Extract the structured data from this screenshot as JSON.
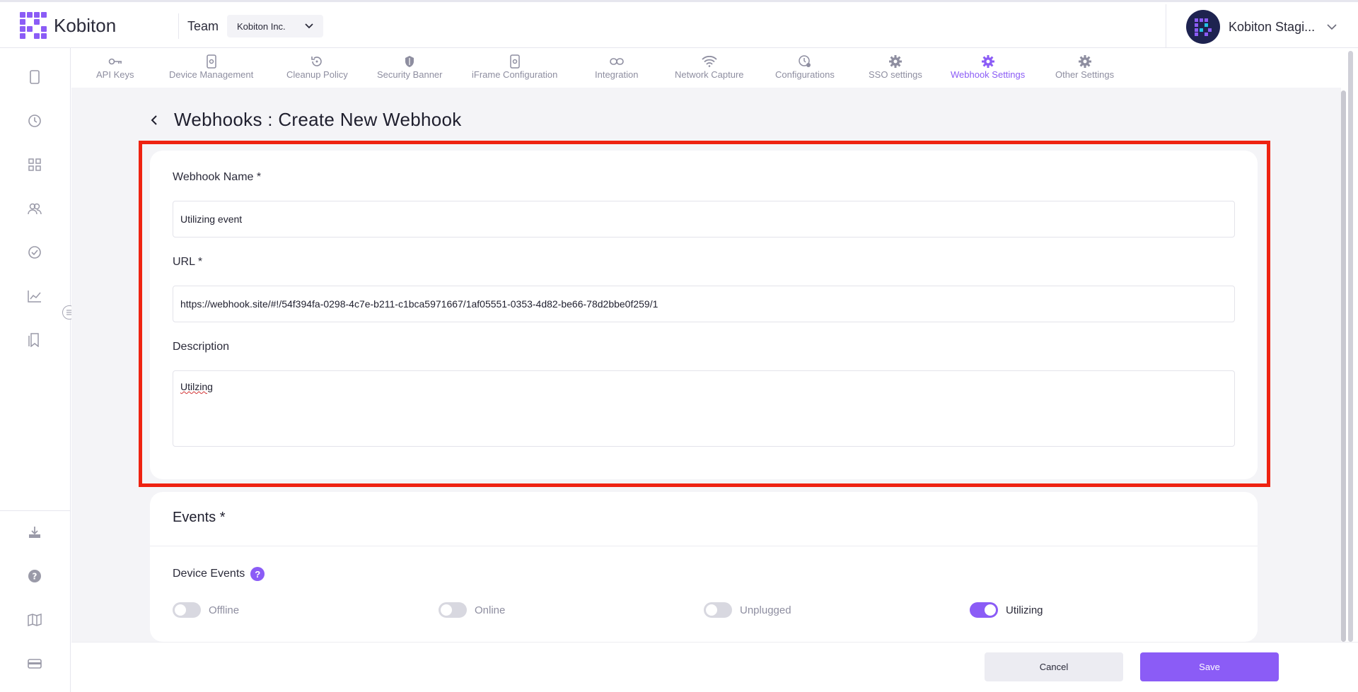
{
  "header": {
    "app_name": "Kobiton",
    "team_label": "Team",
    "team_value": "Kobiton Inc.",
    "user_name": "Kobiton Stagi..."
  },
  "tabs": [
    {
      "label": "API Keys",
      "icon": "key-icon"
    },
    {
      "label": "Device Management",
      "icon": "device-gear-icon"
    },
    {
      "label": "Cleanup Policy",
      "icon": "history-icon"
    },
    {
      "label": "Security Banner",
      "icon": "shield-icon"
    },
    {
      "label": "iFrame Configuration",
      "icon": "frame-gear-icon"
    },
    {
      "label": "Integration",
      "icon": "link-icon"
    },
    {
      "label": "Network Capture",
      "icon": "wifi-icon"
    },
    {
      "label": "Configurations",
      "icon": "clock-gear-icon"
    },
    {
      "label": "SSO settings",
      "icon": "gear-icon"
    },
    {
      "label": "Webhook Settings",
      "icon": "gear-icon",
      "active": true
    },
    {
      "label": "Other Settings",
      "icon": "gear-icon"
    }
  ],
  "page": {
    "title": "Webhooks : Create New Webhook"
  },
  "form": {
    "name_label": "Webhook Name *",
    "name_value": "Utilizing event",
    "url_label": "URL *",
    "url_value": "https://webhook.site/#!/54f394fa-0298-4c7e-b211-c1bca5971667/1af05551-0353-4d82-be66-78d2bbe0f259/1",
    "description_label": "Description",
    "description_value": "Utilzing"
  },
  "events": {
    "title": "Events *",
    "device_events_label": "Device Events",
    "help_glyph": "?",
    "toggles": [
      {
        "label": "Offline",
        "on": false
      },
      {
        "label": "Online",
        "on": false
      },
      {
        "label": "Unplugged",
        "on": false
      },
      {
        "label": "Utilizing",
        "on": true
      }
    ]
  },
  "footer": {
    "cancel_label": "Cancel",
    "save_label": "Save"
  },
  "colors": {
    "accent": "#8b5cf6",
    "highlight": "#ee2211",
    "muted": "#8e8ea0"
  }
}
